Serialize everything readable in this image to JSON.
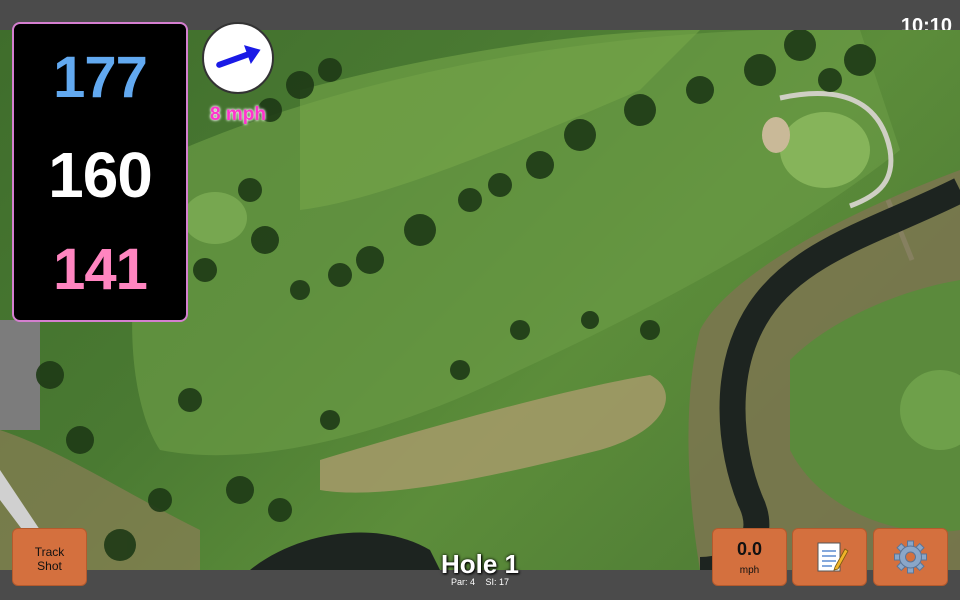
{
  "status": {
    "time": "10:10"
  },
  "distances": {
    "back": "177",
    "middle": "160",
    "front": "141"
  },
  "wind": {
    "speed": "8 mph",
    "icon": "arrow-icon",
    "arrow_color": "#1a1ae6"
  },
  "hole": {
    "title": "Hole 1",
    "par": "Par: 4",
    "si": "SI: 17"
  },
  "buttons": {
    "track_shot_line1": "Track",
    "track_shot_line2": "Shot",
    "speed_value": "0.0",
    "speed_unit": "mph",
    "notes_icon": "notepad-icon",
    "settings_icon": "gear-icon"
  },
  "colors": {
    "button_bg": "#d4703e",
    "back_distance": "#62a9f0",
    "middle_distance": "#ffffff",
    "front_distance": "#ff85c0",
    "wind_text": "#ff33cc",
    "panel_border": "#d57fd0"
  }
}
